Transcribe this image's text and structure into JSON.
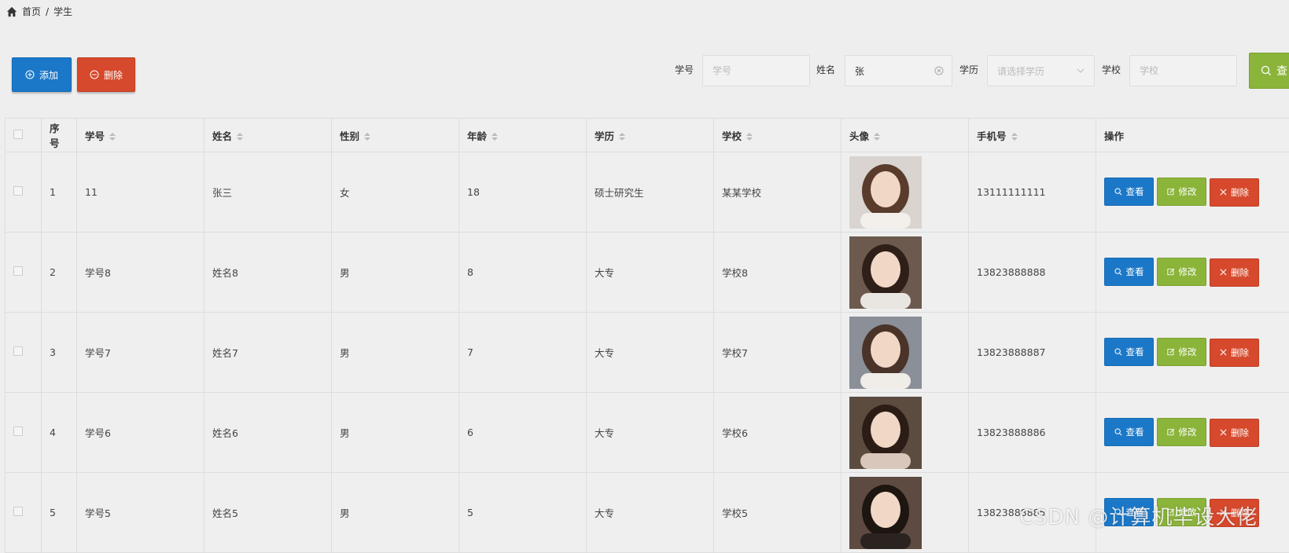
{
  "breadcrumb": {
    "home": "首页",
    "separator": "/",
    "current": "学生"
  },
  "toolbar": {
    "add_label": "添加",
    "delete_label": "删除"
  },
  "search": {
    "student_no_label": "学号",
    "student_no_placeholder": "学号",
    "student_no_value": "",
    "name_label": "姓名",
    "name_placeholder": "姓名",
    "name_value": "张",
    "education_label": "学历",
    "education_placeholder": "请选择学历",
    "school_label": "学校",
    "school_placeholder": "学校",
    "school_value": "",
    "search_button_label": "查"
  },
  "table": {
    "headers": [
      "序号",
      "学号",
      "姓名",
      "性别",
      "年龄",
      "学历",
      "学校",
      "头像",
      "手机号",
      "操作"
    ],
    "rows": [
      {
        "index": "1",
        "student_no": "11",
        "name": "张三",
        "gender": "女",
        "age": "18",
        "education": "硕士研究生",
        "school": "某某学校",
        "phone": "13111111111"
      },
      {
        "index": "2",
        "student_no": "学号8",
        "name": "姓名8",
        "gender": "男",
        "age": "8",
        "education": "大专",
        "school": "学校8",
        "phone": "13823888888"
      },
      {
        "index": "3",
        "student_no": "学号7",
        "name": "姓名7",
        "gender": "男",
        "age": "7",
        "education": "大专",
        "school": "学校7",
        "phone": "13823888887"
      },
      {
        "index": "4",
        "student_no": "学号6",
        "name": "姓名6",
        "gender": "男",
        "age": "6",
        "education": "大专",
        "school": "学校6",
        "phone": "13823888886"
      },
      {
        "index": "5",
        "student_no": "学号5",
        "name": "姓名5",
        "gender": "男",
        "age": "5",
        "education": "大专",
        "school": "学校5",
        "phone": "13823888885"
      }
    ],
    "actions": {
      "view": "查看",
      "edit": "修改",
      "delete": "删除"
    }
  },
  "watermark": "CSDN @计算机毕设大佬",
  "colors": {
    "blue": "#1b78c8",
    "green": "#8bb43a",
    "red": "#d6492c"
  }
}
